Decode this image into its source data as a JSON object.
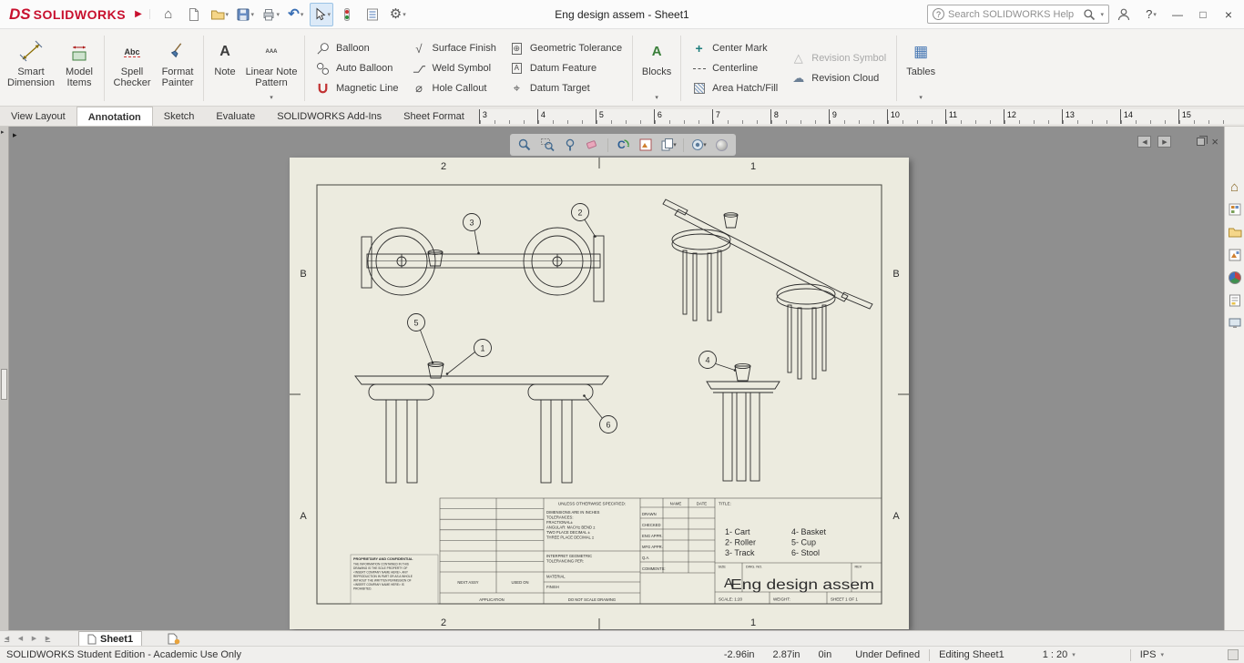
{
  "titlebar": {
    "logo_ds": "DS",
    "logo_name": "SOLIDWORKS",
    "title": "Eng design assem - Sheet1",
    "search_placeholder": "Search SOLIDWORKS Help"
  },
  "glyphs": {
    "home": "⌂",
    "undo": "↶",
    "gear": "⚙",
    "caret": "▾",
    "flyout_arrow": "▶",
    "tree_flyout": "▸",
    "minimize": "—",
    "maximize": "□",
    "close": "×",
    "help": "?",
    "nav_prev": "◀",
    "nav_next": "▶",
    "surface_finish": "√",
    "hole_callout": "⌀",
    "geo_tolerance": "⊕",
    "datum_letter": "A",
    "datum_target": "⌖",
    "center_mark": "+",
    "revision_symbol": "△",
    "revision_cloud": "☁",
    "blocks_letter": "A",
    "tables_grid": "▦",
    "note_letter": "A",
    "pattern_text": "AAA",
    "spell_text": "Abc",
    "threed_view": "C"
  },
  "ribbon": {
    "smart_dimension": "Smart Dimension",
    "model_items": "Model Items",
    "spell_checker": "Spell Checker",
    "format_painter": "Format Painter",
    "note": "Note",
    "linear_note_pattern": "Linear Note Pattern",
    "balloon": "Balloon",
    "auto_balloon": "Auto Balloon",
    "magnetic_line": "Magnetic Line",
    "surface_finish": "Surface Finish",
    "weld_symbol": "Weld Symbol",
    "hole_callout": "Hole Callout",
    "geometric_tolerance": "Geometric Tolerance",
    "datum_feature": "Datum Feature",
    "datum_target": "Datum Target",
    "blocks": "Blocks",
    "center_mark": "Center Mark",
    "centerline": "Centerline",
    "area_hatch": "Area Hatch/Fill",
    "revision_symbol": "Revision Symbol",
    "revision_cloud": "Revision Cloud",
    "tables": "Tables"
  },
  "tabs": [
    {
      "label": "View Layout",
      "active": false
    },
    {
      "label": "Annotation",
      "active": true
    },
    {
      "label": "Sketch",
      "active": false
    },
    {
      "label": "Evaluate",
      "active": false
    },
    {
      "label": "SOLIDWORKS Add-Ins",
      "active": false
    },
    {
      "label": "Sheet Format",
      "active": false
    }
  ],
  "ruler": [
    "3",
    "4",
    "5",
    "6",
    "7",
    "8",
    "9",
    "10",
    "11",
    "12",
    "13",
    "14",
    "15"
  ],
  "sheet": {
    "zones": {
      "top_left": "2",
      "top_right": "1",
      "bottom_left": "2",
      "bottom_right": "1",
      "left_top": "B",
      "left_bottom": "A",
      "right_top": "B",
      "right_bottom": "A"
    },
    "balloons": {
      "b1": "1",
      "b2": "2",
      "b3": "3",
      "b4": "4",
      "b5": "5",
      "b6": "6"
    },
    "titleblock": {
      "unless": "UNLESS OTHERWISE SPECIFIED:",
      "tol1": "DIMENSIONS ARE IN INCHES",
      "tol2": "TOLERANCES:",
      "tol3": "FRACTIONAL±",
      "tol4": "ANGULAR: MACH±   BEND ±",
      "tol5": "TWO PLACE DECIMAL    ±",
      "tol6": "THREE PLACE DECIMAL  ±",
      "interpret1": "INTERPRET GEOMETRIC",
      "interpret2": "TOLERANCING PER:",
      "material": "MATERIAL",
      "finish": "FINISH",
      "name_h": "NAME",
      "date_h": "DATE",
      "drawn": "DRAWN",
      "checked": "CHECKED",
      "eng_appr": "ENG APPR.",
      "mfg_appr": "MFG APPR.",
      "qa": "Q.A.",
      "comments": "COMMENTS:",
      "title_label": "TITLE:",
      "parts": [
        "1- Cart",
        "2- Roller",
        "3- Track",
        "4- Basket",
        "5- Cup",
        "6- Stool"
      ],
      "size_label": "SIZE",
      "size": "A",
      "dwg_label": "DWG. NO.",
      "rev_label": "REV",
      "title": "Eng design assem",
      "scale": "SCALE: 1:20",
      "weight": "WEIGHT:",
      "sheet": "SHEET 1 OF 1",
      "prop_title": "PROPRIETARY AND CONFIDENTIAL",
      "prop_lines": [
        "THE INFORMATION CONTAINED IN THIS",
        "DRAWING IS THE SOLE PROPERTY OF",
        "<INSERT COMPANY NAME HERE>. ANY",
        "REPRODUCTION IN PART OR AS A WHOLE",
        "WITHOUT THE WRITTEN PERMISSION OF",
        "<INSERT COMPANY NAME HERE> IS",
        "PROHIBITED."
      ],
      "next_assy": "NEXT ASSY",
      "used_on": "USED ON",
      "application": "APPLICATION",
      "do_not_scale": "DO NOT SCALE DRAWING"
    }
  },
  "sheettabs": {
    "sheet1": "Sheet1"
  },
  "statusbar": {
    "edition": "SOLIDWORKS Student Edition - Academic Use Only",
    "x": "-2.96in",
    "y": "2.87in",
    "z": "0in",
    "state": "Under Defined",
    "editing": "Editing Sheet1",
    "scale": "1 : 20",
    "units": "IPS"
  }
}
